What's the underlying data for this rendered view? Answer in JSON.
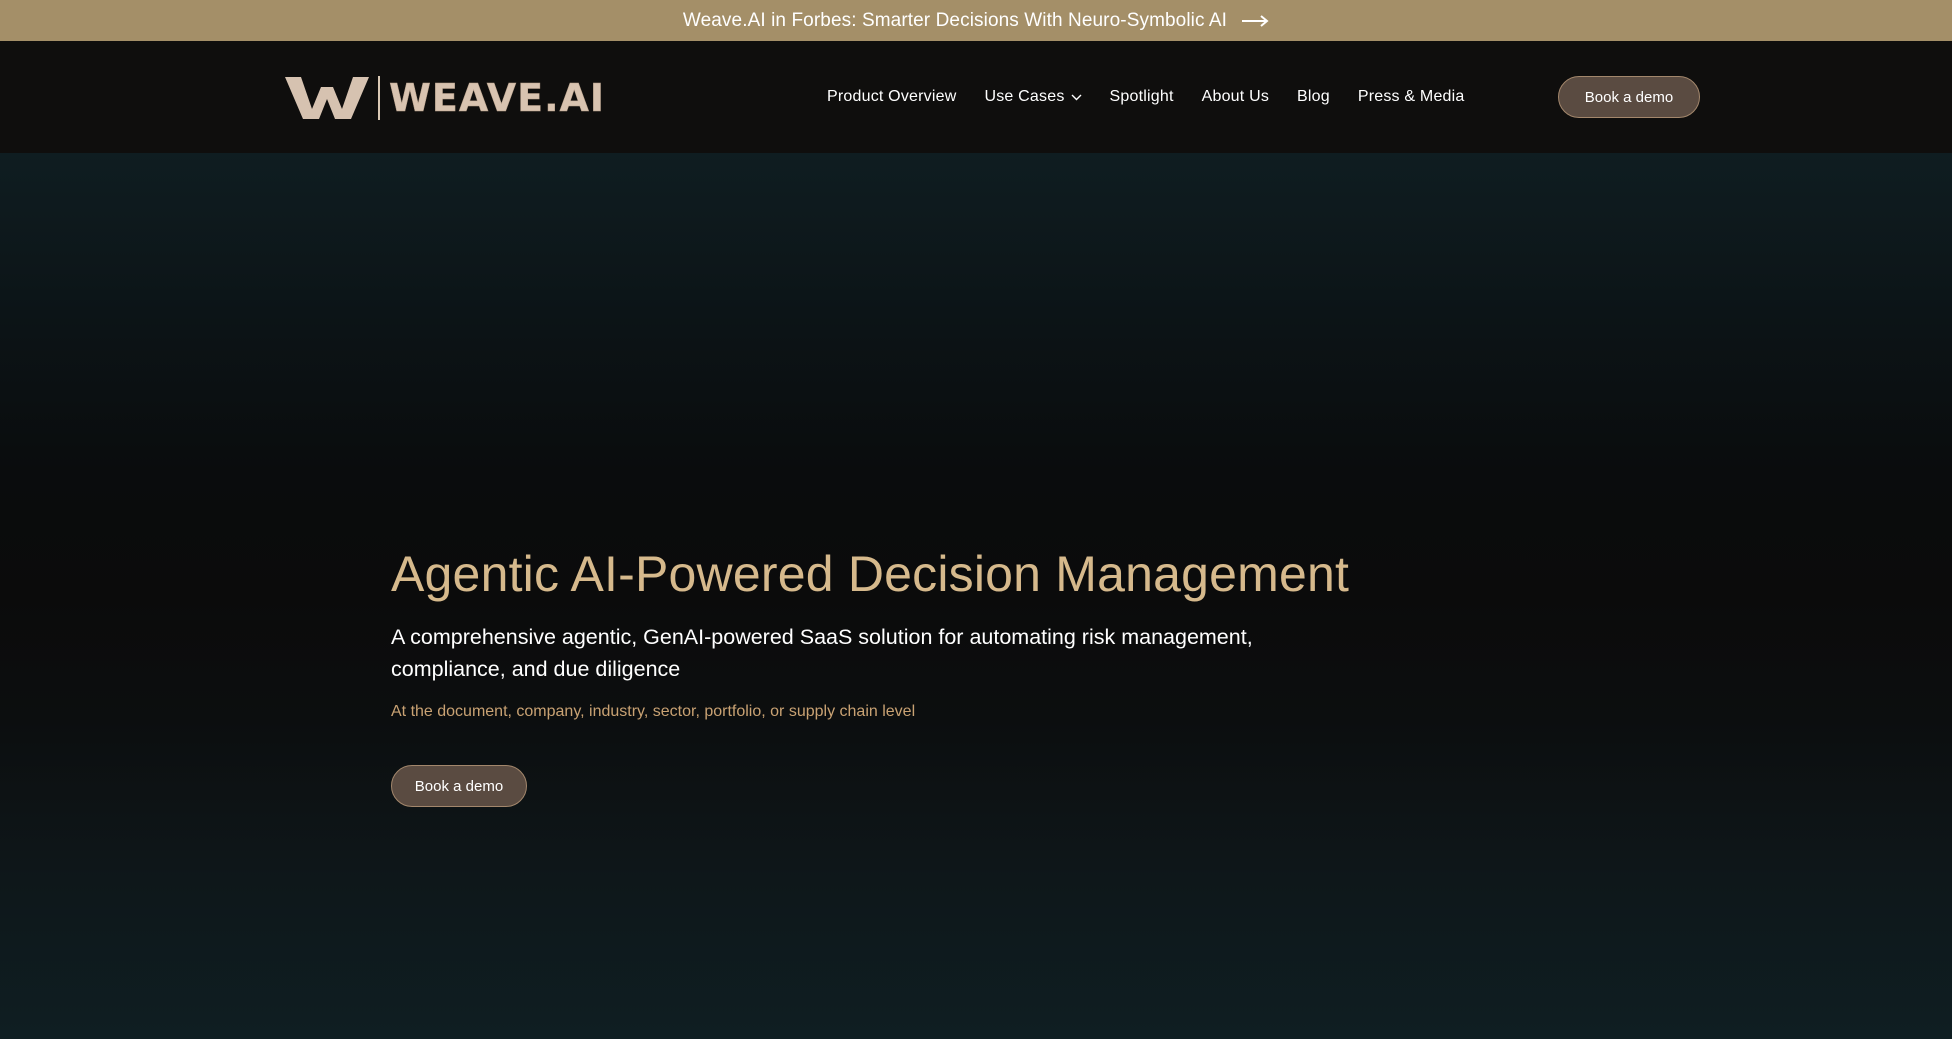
{
  "announcement": {
    "text": "Weave.AI in Forbes: Smarter Decisions With Neuro-Symbolic AI",
    "icon": "arrow-right-icon"
  },
  "header": {
    "logo_text": "WEAVE.AI",
    "nav": [
      {
        "label": "Product Overview"
      },
      {
        "label": "Use Cases",
        "icon": "chevron-down-icon"
      },
      {
        "label": "Spotlight"
      },
      {
        "label": "About Us"
      },
      {
        "label": "Blog"
      },
      {
        "label": "Press & Media"
      }
    ],
    "cta_label": "Book a demo"
  },
  "hero": {
    "title": "Agentic AI-Powered Decision Management",
    "subtitle": "A comprehensive agentic, GenAI-powered SaaS solution for automating risk management, compliance, and due diligence",
    "tagline": "At the document, company, industry, sector, portfolio, or supply chain level",
    "cta_label": "Book a demo"
  },
  "colors": {
    "announcement_bar": "#a48f68",
    "nav_background": "#0f0e0d",
    "accent_gold": "#d6b98c",
    "button_fill": "#5a4b41",
    "button_border": "#a3876c"
  }
}
